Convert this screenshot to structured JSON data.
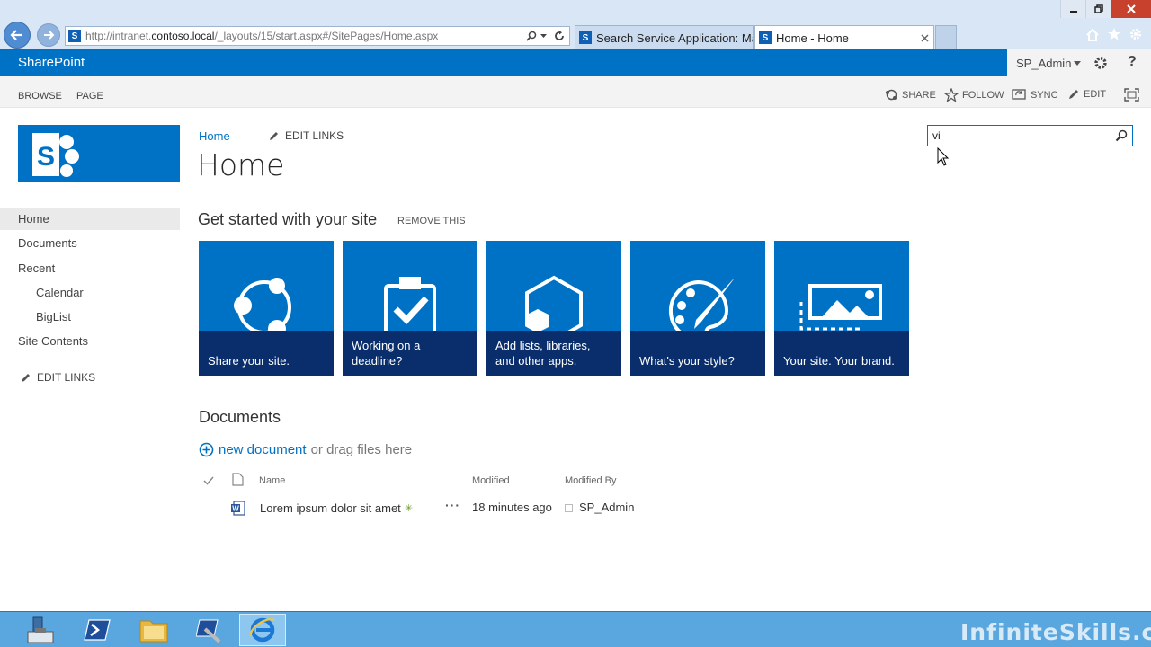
{
  "browser": {
    "address": "http://intranet.contoso.local/_layouts/15/start.aspx#/SitePages/Home.aspx",
    "address_host": "contoso.local",
    "address_prefix": "http://intranet.",
    "address_suffix": "/_layouts/15/start.aspx#/SitePages/Home.aspx",
    "tabs": [
      {
        "label": "Search Service Application: Ma..."
      },
      {
        "label": "Home - Home"
      }
    ],
    "favicon_letter": "S"
  },
  "suite_bar": {
    "brand": "SharePoint",
    "user": "SP_Admin"
  },
  "ribbon": {
    "browse": "BROWSE",
    "page": "PAGE",
    "actions": [
      "SHARE",
      "FOLLOW",
      "SYNC",
      "EDIT"
    ]
  },
  "breadcrumb": {
    "home_link": "Home",
    "edit_links": "EDIT LINKS"
  },
  "page_title": "Home",
  "search": {
    "value": "vi"
  },
  "quick_launch": {
    "items": [
      {
        "label": "Home"
      },
      {
        "label": "Documents"
      },
      {
        "label": "Recent"
      },
      {
        "label": "Calendar"
      },
      {
        "label": "BigList"
      },
      {
        "label": "Site Contents"
      }
    ],
    "edit_links": "EDIT LINKS"
  },
  "get_started": {
    "heading": "Get started with your site",
    "remove": "REMOVE THIS",
    "tiles": [
      {
        "caption": "Share your site.",
        "icon": "share-icon"
      },
      {
        "caption": "Working on a deadline?",
        "icon": "clipboard-check-icon"
      },
      {
        "caption": "Add lists, libraries, and other apps.",
        "icon": "hexagon-apps-icon"
      },
      {
        "caption": "What's your style?",
        "icon": "palette-icon"
      },
      {
        "caption": "Your site. Your brand.",
        "icon": "picture-frame-icon"
      }
    ]
  },
  "documents": {
    "heading": "Documents",
    "new_document": "new document",
    "drag_text": "or drag files here",
    "columns": {
      "name": "Name",
      "modified": "Modified",
      "modified_by": "Modified By"
    },
    "rows": [
      {
        "name": "Lorem ipsum dolor sit amet",
        "modified": "18 minutes ago",
        "modified_by": "SP_Admin"
      }
    ]
  },
  "watermark": "InfiniteSkills.com",
  "colors": {
    "suite_blue": "#0072c6",
    "tile_caption": "#0a2e6b",
    "link_blue": "#0072c6",
    "close_red": "#c7412c"
  }
}
